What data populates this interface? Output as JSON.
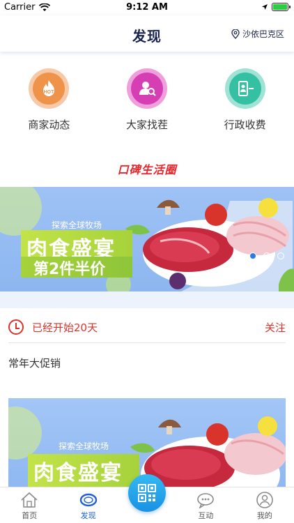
{
  "status_bar": {
    "carrier": "Carrier",
    "time": "9:12 AM",
    "wifi_icon": "wifi-icon",
    "battery_icon": "battery-icon"
  },
  "nav": {
    "title": "发现",
    "location": "沙依巴克区",
    "location_icon": "map-pin-icon"
  },
  "quick_entries": [
    {
      "label": "商家动态",
      "icon": "hot-icon",
      "color": "#f0934a",
      "ring": "#f8c9a6",
      "badge": "HOT"
    },
    {
      "label": "大家找茬",
      "icon": "user-search-icon",
      "color": "#d63fb4",
      "ring": "#ee9fdc"
    },
    {
      "label": "行政收费",
      "icon": "admin-fee-icon",
      "color": "#35bfa3",
      "ring": "#9ee3d3"
    }
  ],
  "section": {
    "logo_text": "口碑生活圈"
  },
  "banner": {
    "top_text": "探索全球牧场",
    "main_text": "肉食盛宴",
    "sub_text": "第2件半价",
    "slide_count": 3,
    "active_slide": 1
  },
  "campaign": {
    "status_icon": "clock-icon",
    "status_text": "已经开始20天",
    "follow_label": "关注",
    "title": "常年大促销",
    "image": {
      "top_text": "探索全球牧场",
      "main_text": "肉食盛宴"
    }
  },
  "tab_bar": {
    "tabs": [
      {
        "label": "首页",
        "icon": "home-icon",
        "active": false
      },
      {
        "label": "发现",
        "icon": "eye-icon",
        "active": true
      },
      {
        "label": "互动",
        "icon": "chat-icon",
        "active": false
      },
      {
        "label": "我的",
        "icon": "profile-icon",
        "active": false
      }
    ],
    "center_icon": "qr-code-icon"
  },
  "colors": {
    "accent": "#1f5fd1",
    "alert": "#d9332b",
    "title": "#1b2450"
  }
}
